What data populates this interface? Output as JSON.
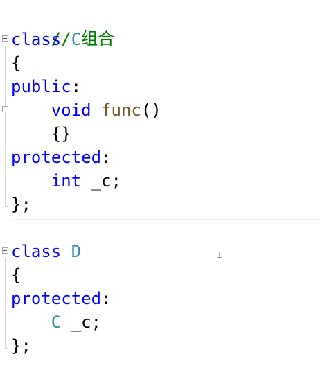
{
  "comment": "// 组合",
  "class_c": {
    "keyword": "class",
    "name": "C",
    "open_brace": "{",
    "access_public": "public",
    "colon1": ":",
    "return_type": "void",
    "method_name": "func",
    "method_parens": "()",
    "method_body": "{}",
    "access_protected": "protected",
    "colon2": ":",
    "member_type": "int",
    "member_name": "_c",
    "member_semicolon": ";",
    "close": "};"
  },
  "class_d": {
    "keyword": "class",
    "name": "D",
    "open_brace": "{",
    "access_protected": "protected",
    "colon": ":",
    "member_type": "C",
    "member_name": "_c",
    "member_semicolon": ";",
    "close": "};"
  },
  "colors": {
    "keyword": "#0000ff",
    "type": "#2b91af",
    "function": "#74531f",
    "comment": "#008000"
  }
}
